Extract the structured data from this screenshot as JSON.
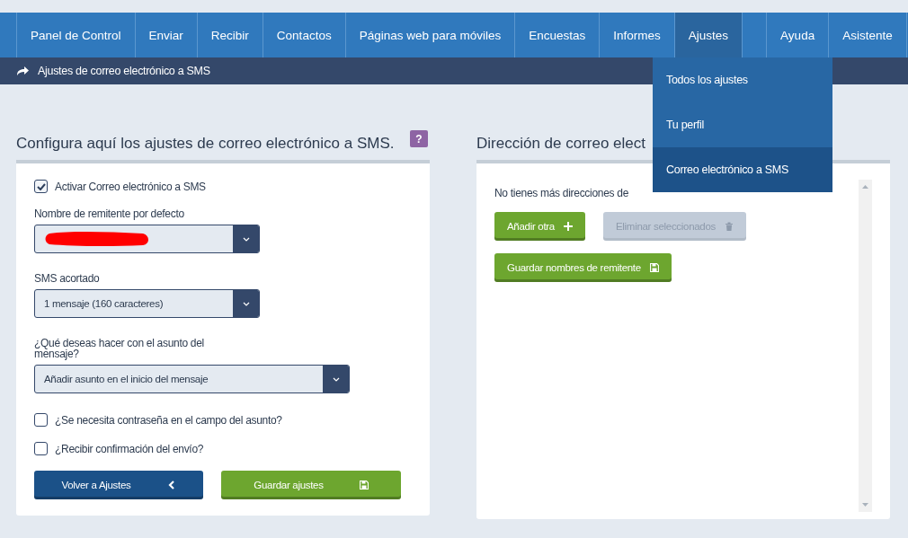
{
  "nav": {
    "items": [
      {
        "label": "Panel de Control",
        "selected": false
      },
      {
        "label": "Enviar",
        "selected": false
      },
      {
        "label": "Recibir",
        "selected": false
      },
      {
        "label": "Contactos",
        "selected": false
      },
      {
        "label": "Páginas web para móviles",
        "selected": false
      },
      {
        "label": "Encuestas",
        "selected": false
      },
      {
        "label": "Informes",
        "selected": false
      },
      {
        "label": "Ajustes",
        "selected": true
      },
      {
        "kind": "spacer",
        "selected": false
      },
      {
        "label": "Ayuda",
        "selected": false
      },
      {
        "label": "Asistente",
        "selected": false
      }
    ],
    "menu": [
      {
        "label": "Todos los ajustes",
        "selected": false
      },
      {
        "label": "Tu perfil",
        "selected": false
      },
      {
        "label": "Correo electrónico a SMS",
        "selected": true
      }
    ]
  },
  "breadcrumb": "Ajustes de correo electrónico a SMS",
  "settings": {
    "title": "Configura aquí los ajustes de correo electrónico a SMS.",
    "help": "?",
    "fields": [
      {
        "kind": "checkbox",
        "label": "Activar Correo electrónico a SMS",
        "checked": true
      },
      {
        "kind": "select",
        "label": "Nombre de remitente por defecto",
        "redacted": true,
        "wide": false
      },
      {
        "kind": "select",
        "label": "SMS acortado",
        "value": "1 mensaje (160 caracteres)",
        "wide": false
      },
      {
        "kind": "select",
        "label": "¿Qué deseas hacer con el asunto del mensaje?",
        "value": "Añadir asunto en el inicio del mensaje",
        "wide": true
      },
      {
        "kind": "checkbox",
        "label": "¿Se necesita contraseña en el campo del asunto?",
        "checked": false
      },
      {
        "kind": "checkbox",
        "label": "¿Recibir confirmación del envío?",
        "checked": false
      }
    ],
    "buttons": [
      {
        "label": "Volver a Ajustes",
        "kind": "back"
      },
      {
        "label": "Guardar ajustes",
        "kind": "save"
      }
    ]
  },
  "addresses": {
    "title": "Dirección de correo elect",
    "message": "No tienes más direcciones de",
    "buttons": [
      {
        "label": "Añadir otra",
        "kind": "add",
        "disabled": false
      },
      {
        "label": "Eliminar seleccionados",
        "kind": "delete",
        "disabled": true
      },
      {
        "label": "Guardar nombres de remitente",
        "kind": "save",
        "disabled": false
      }
    ]
  }
}
